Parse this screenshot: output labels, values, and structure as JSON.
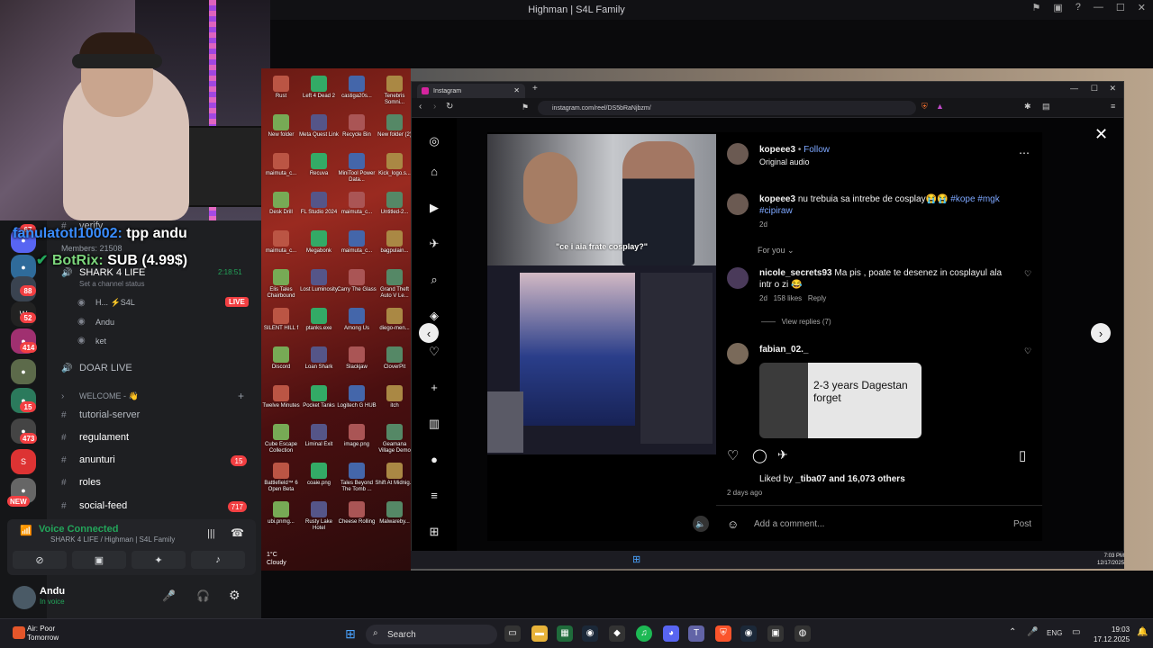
{
  "window_title": "Highman | S4L Family",
  "overlay": {
    "chat_user": "fanulatotl10002:",
    "chat_msg": "tpp andu",
    "bot_user": "BotRix:",
    "bot_msg": "SUB (4.99$)"
  },
  "discord": {
    "guild_badges": [
      "67",
      "88",
      "52",
      "414",
      "15",
      "473",
      "NEW"
    ],
    "top_items": {
      "verify": "verify",
      "members": "Members: 21508",
      "status_channel": "SHARK 4 LIFE",
      "status_time": "2:18:51",
      "set_status": "Set a channel status"
    },
    "voice_users": [
      {
        "name": "H... ⚡S4L",
        "badge": "LIVE"
      },
      {
        "name": "Andu"
      },
      {
        "name": "ket"
      }
    ],
    "channels": [
      {
        "label": "DOAR LIVE"
      },
      {
        "label": "WELCOME - 👋"
      },
      {
        "label": "tutorial-server"
      },
      {
        "label": "regulament"
      },
      {
        "label": "anunturi",
        "badge": "15"
      },
      {
        "label": "roles"
      },
      {
        "label": "social-feed",
        "badge": "717"
      }
    ],
    "voice": {
      "title": "Voice Connected",
      "sub": "SHARK 4 LIFE / Highman | S4L Family"
    },
    "user": {
      "name": "Andu",
      "status": "In voice"
    }
  },
  "desktop_icons": [
    "Rust",
    "Left 4 Dead 2",
    "castiga20s...",
    "Tenebris Somni...",
    "New folder",
    "Meta Quest Link",
    "Recycle Bin",
    "New folder (2)",
    "maimuta_c...",
    "Recuva",
    "MiniTool Power Data...",
    "Kick_logo.s...",
    "Desk Drill",
    "FL Studio 2024",
    "maimuta_c...",
    "Untitled-2...",
    "maimuta_c...",
    "Megabonk",
    "maimuta_c...",
    "bagpulain...",
    "Elis Tales Chairbound",
    "Lost Luminosity",
    "Carry The Glass",
    "Grand Theft Auto V Le...",
    "SILENT HILL f",
    "ptanks.exe",
    "Among Us",
    "diego-men...",
    "Discord",
    "Loan Shark",
    "Slackjaw",
    "CloverPit",
    "Twelve Minutes",
    "Pocket Tanks",
    "Logitech G HUB",
    "itch",
    "Cube Escape Collection",
    "Liminal Exit",
    "image.png",
    "Geamana Village Demo",
    "Battlefield™ 6 Open Beta",
    "coaie.png",
    "Tales Beyond The Tomb ...",
    "Shift At Midnig...",
    "ubi.pnmg...",
    "Rusty Lake Hotel",
    "Cheese Rolling",
    "Malwareby..."
  ],
  "desktop_weather": {
    "temp": "1°C",
    "cond": "Cloudy"
  },
  "browser": {
    "tab_title": "Instagram",
    "url": "instagram.com/reel/DS5bRaNjbzm/"
  },
  "reel": {
    "caption_overlay": "\"ce i aia frate cosplay?\""
  },
  "post": {
    "author": "kopeee3",
    "follow": "Follow",
    "audio": "Original audio",
    "caption_user": "kopeee3",
    "caption_text": "nu trebuia sa intrebe de cosplay😭😭",
    "tags": "#kope #mgk",
    "tags2": "#cipiraw",
    "caption_age": "2d",
    "for_you": "For you",
    "comment1_user": "nicole_secrets93",
    "comment1_text": "Ma pis , poate te desenez in cosplayul ala intr o zi 😂",
    "comment1_age": "2d",
    "comment1_likes": "158 likes",
    "comment1_reply": "Reply",
    "view_replies": "View replies (7)",
    "comment2_user": "fabian_02._",
    "meme_text": "2-3 years Dagestan forget",
    "liked_by_prefix": "Liked by",
    "liked_by_user": "_tiba07",
    "liked_by_suffix": "and 16,073 others",
    "post_age": "2 days ago",
    "add_comment": "Add a comment...",
    "post_btn": "Post"
  },
  "inner_clock": {
    "time": "7:03 PM",
    "date": "12/17/2025"
  },
  "taskbar": {
    "weather_title": "Air: Poor",
    "weather_sub": "Tomorrow",
    "search": "Search",
    "lang": "ENG",
    "time": "19:03",
    "date": "17.12.2025"
  }
}
